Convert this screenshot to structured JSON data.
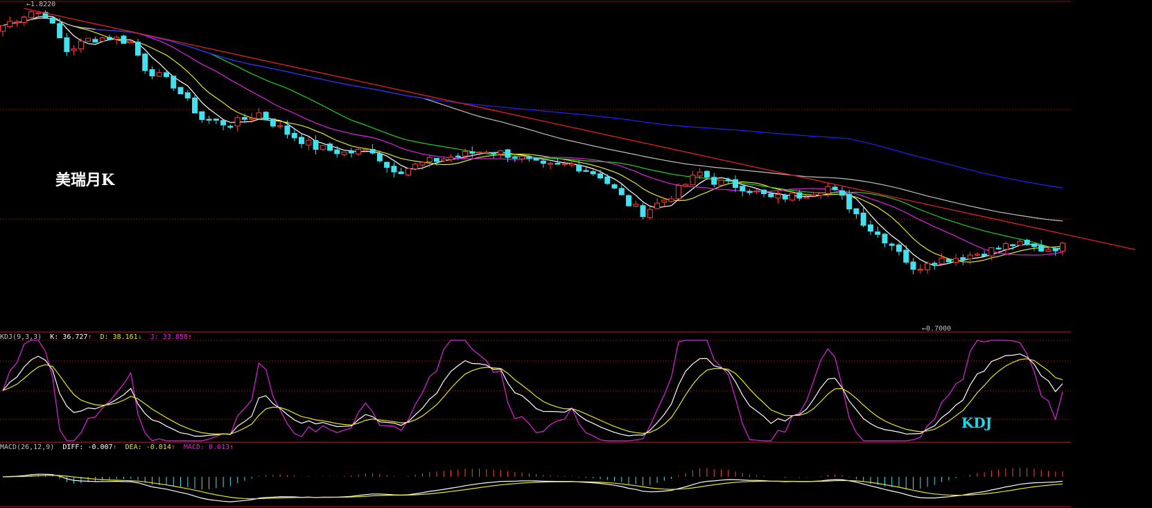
{
  "title": "美瑞月K",
  "kdj_label": "KDJ",
  "price": {
    "high_label": "1.8220",
    "low_label": "0.7000"
  },
  "kdj_header": {
    "name": "KDJ(9,3,3)",
    "k": "K: 36.727",
    "d": "D: 38.161",
    "j": "J: 33.858"
  },
  "macd_header": {
    "name": "MACD(26,12,9)",
    "diff": "DIFF: -0.007",
    "dea": "DEA: -0.014",
    "macd": "MACD: 0.013"
  },
  "colors": {
    "background": "#000000",
    "up": "#ff4040",
    "down": "#44e0ee",
    "ma5": "#ffffff",
    "ma10": "#e8e820",
    "ma20": "#e020e0",
    "ma30": "#20d020",
    "ma60": "#c0c0c0",
    "ma120": "#2020ff",
    "trend": "#e02020",
    "grid": "#8a1010"
  },
  "chart_data": [
    {
      "type": "candlestick",
      "title": "美瑞月K",
      "ylim": [
        0.68,
        1.83
      ],
      "annotations": [
        "1.8220",
        "0.7000"
      ],
      "waypoints": [
        [
          0,
          1.75
        ],
        [
          4,
          1.8
        ],
        [
          6,
          1.79
        ],
        [
          9,
          1.66
        ],
        [
          12,
          1.7
        ],
        [
          15,
          1.71
        ],
        [
          18,
          1.69
        ],
        [
          20,
          1.6
        ],
        [
          24,
          1.54
        ],
        [
          28,
          1.42
        ],
        [
          32,
          1.4
        ],
        [
          36,
          1.44
        ],
        [
          40,
          1.37
        ],
        [
          44,
          1.32
        ],
        [
          48,
          1.3
        ],
        [
          52,
          1.31
        ],
        [
          54,
          1.25
        ],
        [
          56,
          1.24
        ],
        [
          60,
          1.27
        ],
        [
          64,
          1.29
        ],
        [
          68,
          1.31
        ],
        [
          72,
          1.29
        ],
        [
          76,
          1.25
        ],
        [
          80,
          1.26
        ],
        [
          84,
          1.22
        ],
        [
          88,
          1.12
        ],
        [
          90,
          1.09
        ],
        [
          94,
          1.15
        ],
        [
          98,
          1.23
        ],
        [
          100,
          1.2
        ],
        [
          104,
          1.18
        ],
        [
          108,
          1.14
        ],
        [
          112,
          1.15
        ],
        [
          116,
          1.18
        ],
        [
          118,
          1.14
        ],
        [
          122,
          1.03
        ],
        [
          126,
          0.96
        ],
        [
          128,
          0.88
        ],
        [
          130,
          0.92
        ],
        [
          134,
          0.93
        ],
        [
          138,
          0.95
        ],
        [
          142,
          0.98
        ],
        [
          146,
          0.96
        ],
        [
          149,
          0.97
        ]
      ],
      "ma_periods": [
        5,
        10,
        20,
        30,
        60,
        120
      ],
      "trendline": [
        [
          3,
          1.81
        ],
        [
          170,
          0.9
        ]
      ]
    },
    {
      "type": "line",
      "title": "KDJ(9,3,3)",
      "series": [
        {
          "name": "K",
          "last": 36.727
        },
        {
          "name": "D",
          "last": 38.161
        },
        {
          "name": "J",
          "last": 33.858
        }
      ],
      "ylim": [
        0,
        100
      ]
    },
    {
      "type": "bar",
      "title": "MACD(26,12,9)",
      "series": [
        {
          "name": "DIFF",
          "last": -0.007
        },
        {
          "name": "DEA",
          "last": -0.014
        },
        {
          "name": "MACD",
          "last": 0.013
        }
      ]
    }
  ]
}
